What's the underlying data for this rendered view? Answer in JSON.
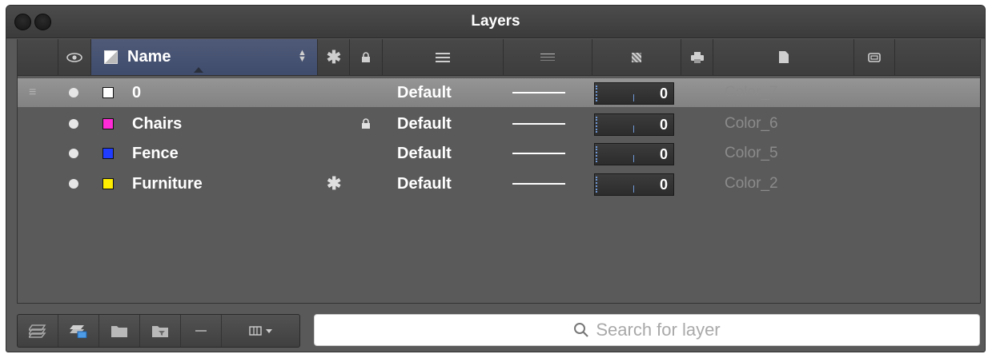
{
  "window": {
    "title": "Layers"
  },
  "header": {
    "name_label": "Name"
  },
  "layers": [
    {
      "name": "0",
      "color": "#ffffff",
      "linetype": "Default",
      "transparency": "0",
      "plot_style": "Color_7",
      "locked": false,
      "frozen": false,
      "selected": true
    },
    {
      "name": "Chairs",
      "color": "#ff2bd6",
      "linetype": "Default",
      "transparency": "0",
      "plot_style": "Color_6",
      "locked": true,
      "frozen": false,
      "selected": false
    },
    {
      "name": "Fence",
      "color": "#1f3cff",
      "linetype": "Default",
      "transparency": "0",
      "plot_style": "Color_5",
      "locked": false,
      "frozen": false,
      "selected": false
    },
    {
      "name": "Furniture",
      "color": "#ffee00",
      "linetype": "Default",
      "transparency": "0",
      "plot_style": "Color_2",
      "locked": false,
      "frozen": true,
      "selected": false
    }
  ],
  "search": {
    "placeholder": "Search for layer"
  }
}
